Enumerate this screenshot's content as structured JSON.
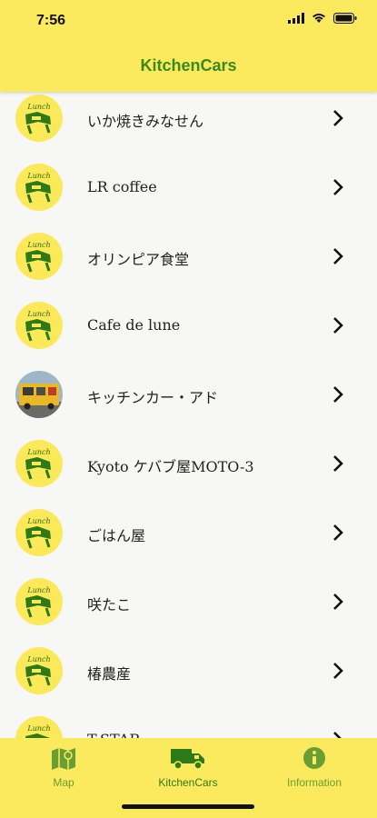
{
  "status": {
    "time": "7:56"
  },
  "app": {
    "title": "KitchenCars"
  },
  "list": [
    {
      "label": "いか焼きみなせん",
      "avatar": "lunch-logo"
    },
    {
      "label": "LR coffee",
      "avatar": "lunch-logo"
    },
    {
      "label": "オリンピア食堂",
      "avatar": "lunch-logo"
    },
    {
      "label": "Cafe de lune",
      "avatar": "lunch-logo"
    },
    {
      "label": "キッチンカー・アド",
      "avatar": "truck-photo"
    },
    {
      "label": "Kyoto ケバブ屋MOTO-3",
      "avatar": "lunch-logo"
    },
    {
      "label": "ごはん屋",
      "avatar": "lunch-logo"
    },
    {
      "label": "咲たこ",
      "avatar": "lunch-logo"
    },
    {
      "label": "椿農産",
      "avatar": "lunch-logo"
    },
    {
      "label": "T-STAR",
      "avatar": "lunch-logo"
    }
  ],
  "tabs": [
    {
      "label": "Map",
      "icon": "map-icon",
      "active": false
    },
    {
      "label": "KitchenCars",
      "icon": "truck-icon",
      "active": true
    },
    {
      "label": "Information",
      "icon": "info-icon",
      "active": false
    }
  ],
  "colors": {
    "header": "#fbea5e",
    "accent": "#3a8a20",
    "inactive": "#6a9e33"
  }
}
